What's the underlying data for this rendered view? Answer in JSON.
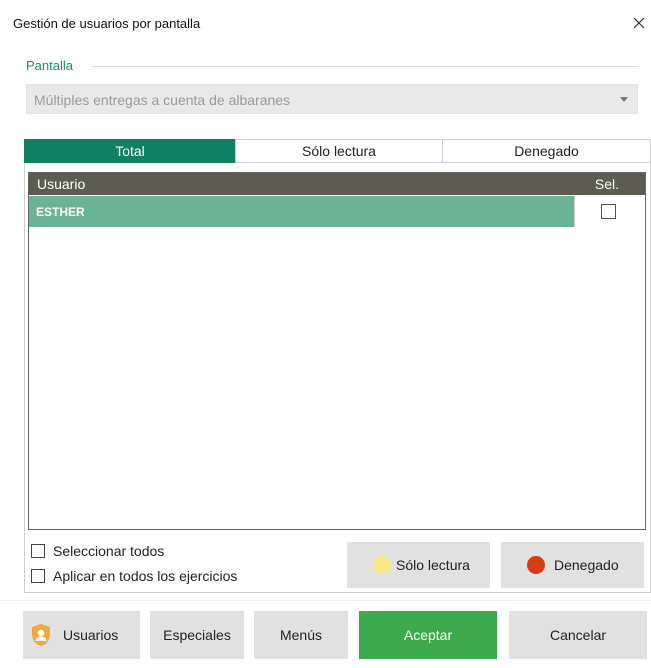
{
  "window": {
    "title": "Gestión de usuarios por pantalla",
    "close_glyph": "×"
  },
  "pantalla": {
    "label": "Pantalla",
    "selected": "Múltiples entregas a cuenta de albaranes"
  },
  "tabs": [
    {
      "label": "Total",
      "active": true
    },
    {
      "label": "Sólo lectura",
      "active": false
    },
    {
      "label": "Denegado",
      "active": false
    }
  ],
  "grid": {
    "columns": {
      "user": "Usuario",
      "sel": "Sel."
    },
    "rows": [
      {
        "user": "ESTHER",
        "selected": false
      }
    ]
  },
  "options": {
    "select_all": "Seleccionar todos",
    "apply_all": "Aplicar en todos los ejercicios"
  },
  "actions": {
    "readonly": "Sólo lectura",
    "denied": "Denegado"
  },
  "footer": {
    "users": "Usuarios",
    "special": "Especiales",
    "menus": "Menús",
    "accept": "Aceptar",
    "cancel": "Cancelar"
  },
  "colors": {
    "accent": "#0f8064",
    "row_highlight": "#6bb395",
    "accept_button": "#3caa4c",
    "readonly_dot": "#f5ea86",
    "denied_dot": "#d83b12",
    "shield_icon": "#f2a93b"
  }
}
